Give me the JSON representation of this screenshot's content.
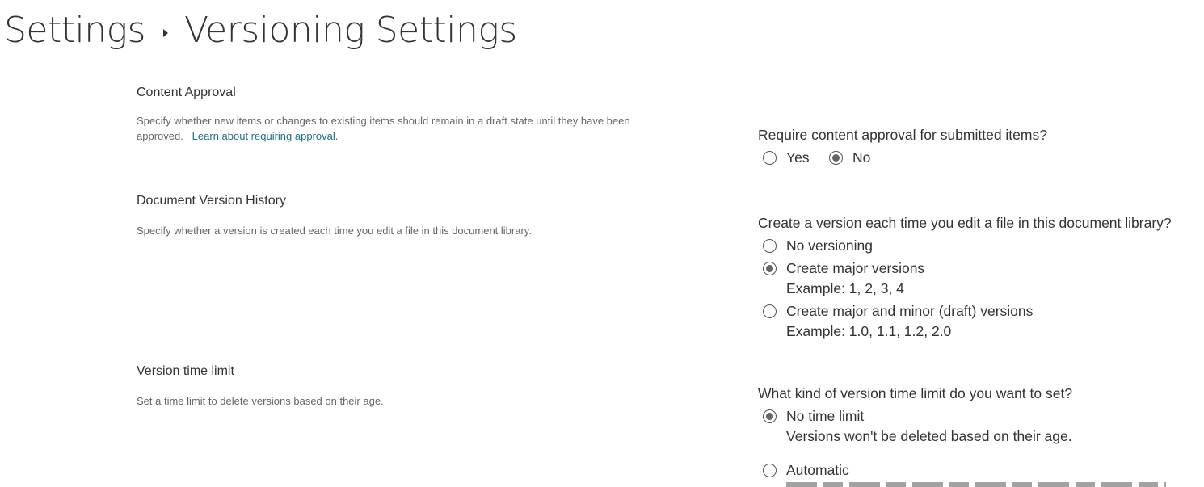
{
  "breadcrumb": {
    "parent": "Settings",
    "current": "Versioning Settings"
  },
  "sections": {
    "content_approval": {
      "title": "Content Approval",
      "description": "Specify whether new items or changes to existing items should remain in a draft state until they have been approved.",
      "link": "Learn about requiring approval.",
      "question": "Require content approval for submitted items?",
      "options": [
        {
          "label": "Yes",
          "checked": false
        },
        {
          "label": "No",
          "checked": true
        }
      ]
    },
    "version_history": {
      "title": "Document Version History",
      "description": "Specify whether a version is created each time you edit a file in this document library.",
      "question": "Create a version each time you edit a file in this document library?",
      "options": [
        {
          "label": "No versioning",
          "checked": false
        },
        {
          "label": "Create major versions",
          "example": "Example: 1, 2, 3, 4",
          "checked": true
        },
        {
          "label": "Create major and minor (draft) versions",
          "example": "Example: 1.0, 1.1, 1.2, 2.0",
          "checked": false
        }
      ]
    },
    "time_limit": {
      "title": "Version time limit",
      "description": "Set a time limit to delete versions based on their age.",
      "question": "What kind of version time limit do you want to set?",
      "options": [
        {
          "label": "No time limit",
          "example": "Versions won't be deleted based on their age.",
          "checked": true
        },
        {
          "label": "Automatic",
          "checked": false
        }
      ]
    }
  }
}
